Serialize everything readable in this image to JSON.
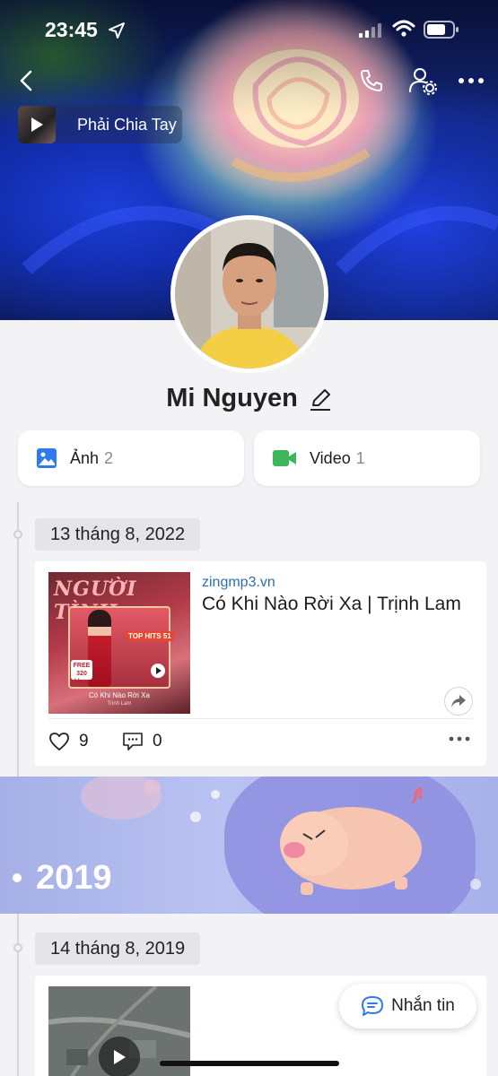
{
  "status_bar": {
    "time": "23:45"
  },
  "header": {
    "music_title": "Phải Chia Tay"
  },
  "profile": {
    "name": "Mi Nguyen"
  },
  "media": {
    "photos_label": "Ảnh",
    "photos_count": "2",
    "videos_label": "Video",
    "videos_count": "1"
  },
  "timeline": {
    "entries": [
      {
        "date": "13 tháng 8, 2022",
        "source": "zingmp3.vn",
        "title": "Có Khi Nào Rời Xa | Trịnh Lam",
        "thumbnail": {
          "heading": "NGƯỜI TÌNH",
          "badge": "TOP HITS 51",
          "free": "FREE",
          "kbps_value": "320",
          "kbps_unit": "kbps",
          "caption": "Có Khi Nào Rời Xa",
          "artist": "Trịnh Lam"
        },
        "likes": "9",
        "comments": "0"
      },
      {
        "date": "14 tháng 8, 2019"
      }
    ],
    "year_banner": "2019"
  },
  "message_button": {
    "label": "Nhắn tin"
  },
  "colors": {
    "accent_blue": "#2e6fb0",
    "video_green": "#3cb65a",
    "photo_blue": "#2e7bf0"
  }
}
